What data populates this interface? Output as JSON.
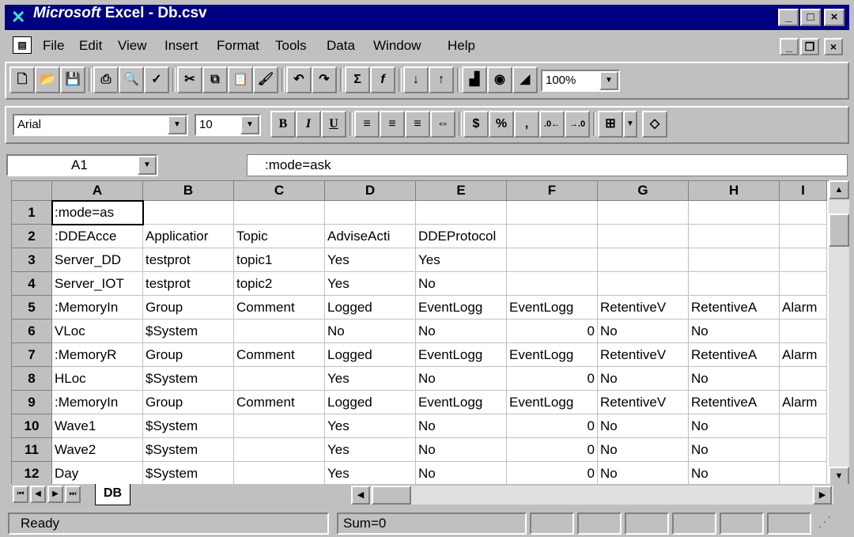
{
  "window": {
    "title_brand": "Microsoft",
    "title_rest": " Excel - Db.csv",
    "buttons": [
      "_",
      "□",
      "×"
    ]
  },
  "menu": {
    "items": [
      "File",
      "Edit",
      "View",
      "Insert",
      "Format",
      "Tools",
      "Data",
      "Window",
      "Help"
    ],
    "mdi_buttons": [
      "_",
      "❐",
      "×"
    ]
  },
  "toolbar_standard": {
    "zoom": "100%"
  },
  "toolbar_format": {
    "font": "Arial",
    "size": "10",
    "bold": "B",
    "italic": "I",
    "underline": "U",
    "currency": "$",
    "percent": "%",
    "comma": ","
  },
  "formula_bar": {
    "name_box": "A1",
    "content": ":mode=ask"
  },
  "grid": {
    "columns": [
      "A",
      "B",
      "C",
      "D",
      "E",
      "F",
      "G",
      "H",
      "I"
    ],
    "rows": [
      {
        "num": "1",
        "cells": [
          ":mode=as",
          "",
          "",
          "",
          "",
          "",
          "",
          "",
          ""
        ]
      },
      {
        "num": "2",
        "cells": [
          ":DDEAcce",
          "Applicatior",
          "Topic",
          "AdviseActi",
          "DDEProtocol",
          "",
          "",
          "",
          ""
        ]
      },
      {
        "num": "3",
        "cells": [
          "Server_DD",
          "testprot",
          "topic1",
          "Yes",
          "Yes",
          "",
          "",
          "",
          ""
        ]
      },
      {
        "num": "4",
        "cells": [
          "Server_IOT",
          "testprot",
          "topic2",
          "Yes",
          "No",
          "",
          "",
          "",
          ""
        ]
      },
      {
        "num": "5",
        "cells": [
          ":MemoryIn",
          "Group",
          "Comment",
          "Logged",
          "EventLogg",
          "EventLogg",
          "RetentiveV",
          "RetentiveA",
          "Alarm"
        ]
      },
      {
        "num": "6",
        "cells": [
          "VLoc",
          "$System",
          "",
          "No",
          "No",
          "0",
          "No",
          "No",
          ""
        ]
      },
      {
        "num": "7",
        "cells": [
          ":MemoryR",
          "Group",
          "Comment",
          "Logged",
          "EventLogg",
          "EventLogg",
          "RetentiveV",
          "RetentiveA",
          "Alarm"
        ]
      },
      {
        "num": "8",
        "cells": [
          "HLoc",
          "$System",
          "",
          "Yes",
          "No",
          "0",
          "No",
          "No",
          ""
        ]
      },
      {
        "num": "9",
        "cells": [
          ":MemoryIn",
          "Group",
          "Comment",
          "Logged",
          "EventLogg",
          "EventLogg",
          "RetentiveV",
          "RetentiveA",
          "Alarm"
        ]
      },
      {
        "num": "10",
        "cells": [
          "Wave1",
          "$System",
          "",
          "Yes",
          "No",
          "0",
          "No",
          "No",
          ""
        ]
      },
      {
        "num": "11",
        "cells": [
          "Wave2",
          "$System",
          "",
          "Yes",
          "No",
          "0",
          "No",
          "No",
          ""
        ]
      },
      {
        "num": "12",
        "cells": [
          "Day",
          "$System",
          "",
          "Yes",
          "No",
          "0",
          "No",
          "No",
          ""
        ]
      }
    ]
  },
  "sheet_tabs": [
    "DB"
  ],
  "status": {
    "left": "Ready",
    "sum": "Sum=0"
  }
}
